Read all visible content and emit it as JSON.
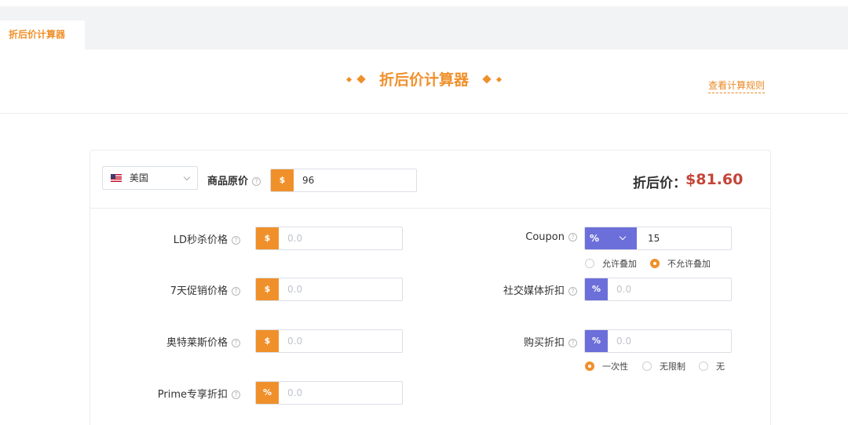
{
  "tab": {
    "label": "折后价计算器"
  },
  "header": {
    "title": "折后价计算器",
    "rules_link": "查看计算规则"
  },
  "top": {
    "country": "美国",
    "original_price_label": "商品原价",
    "currency_symbol": "$",
    "original_price_value": "96",
    "result_label": "折后价：",
    "result_value": "$81.60"
  },
  "left_fields": [
    {
      "label": "LD秒杀价格",
      "prefix": "$",
      "placeholder": "0.0"
    },
    {
      "label": "7天促销价格",
      "prefix": "$",
      "placeholder": "0.0"
    },
    {
      "label": "奥特莱斯价格",
      "prefix": "$",
      "placeholder": "0.0"
    },
    {
      "label": "Prime专享折扣",
      "prefix": "%",
      "placeholder": "0.0"
    }
  ],
  "coupon": {
    "label": "Coupon",
    "type": "%",
    "value": "15",
    "options": [
      "允许叠加",
      "不允许叠加"
    ],
    "selected": "不允许叠加"
  },
  "social": {
    "label": "社交媒体折扣",
    "prefix": "%",
    "placeholder": "0.0"
  },
  "purchase": {
    "label": "购买折扣",
    "prefix": "%",
    "placeholder": "0.0",
    "options": [
      "一次性",
      "无限制",
      "无"
    ],
    "selected": "一次性"
  },
  "help_glyph": "?",
  "colors": {
    "accent": "#f0902b",
    "blue": "#6c6fd9",
    "result": "#c44539"
  }
}
